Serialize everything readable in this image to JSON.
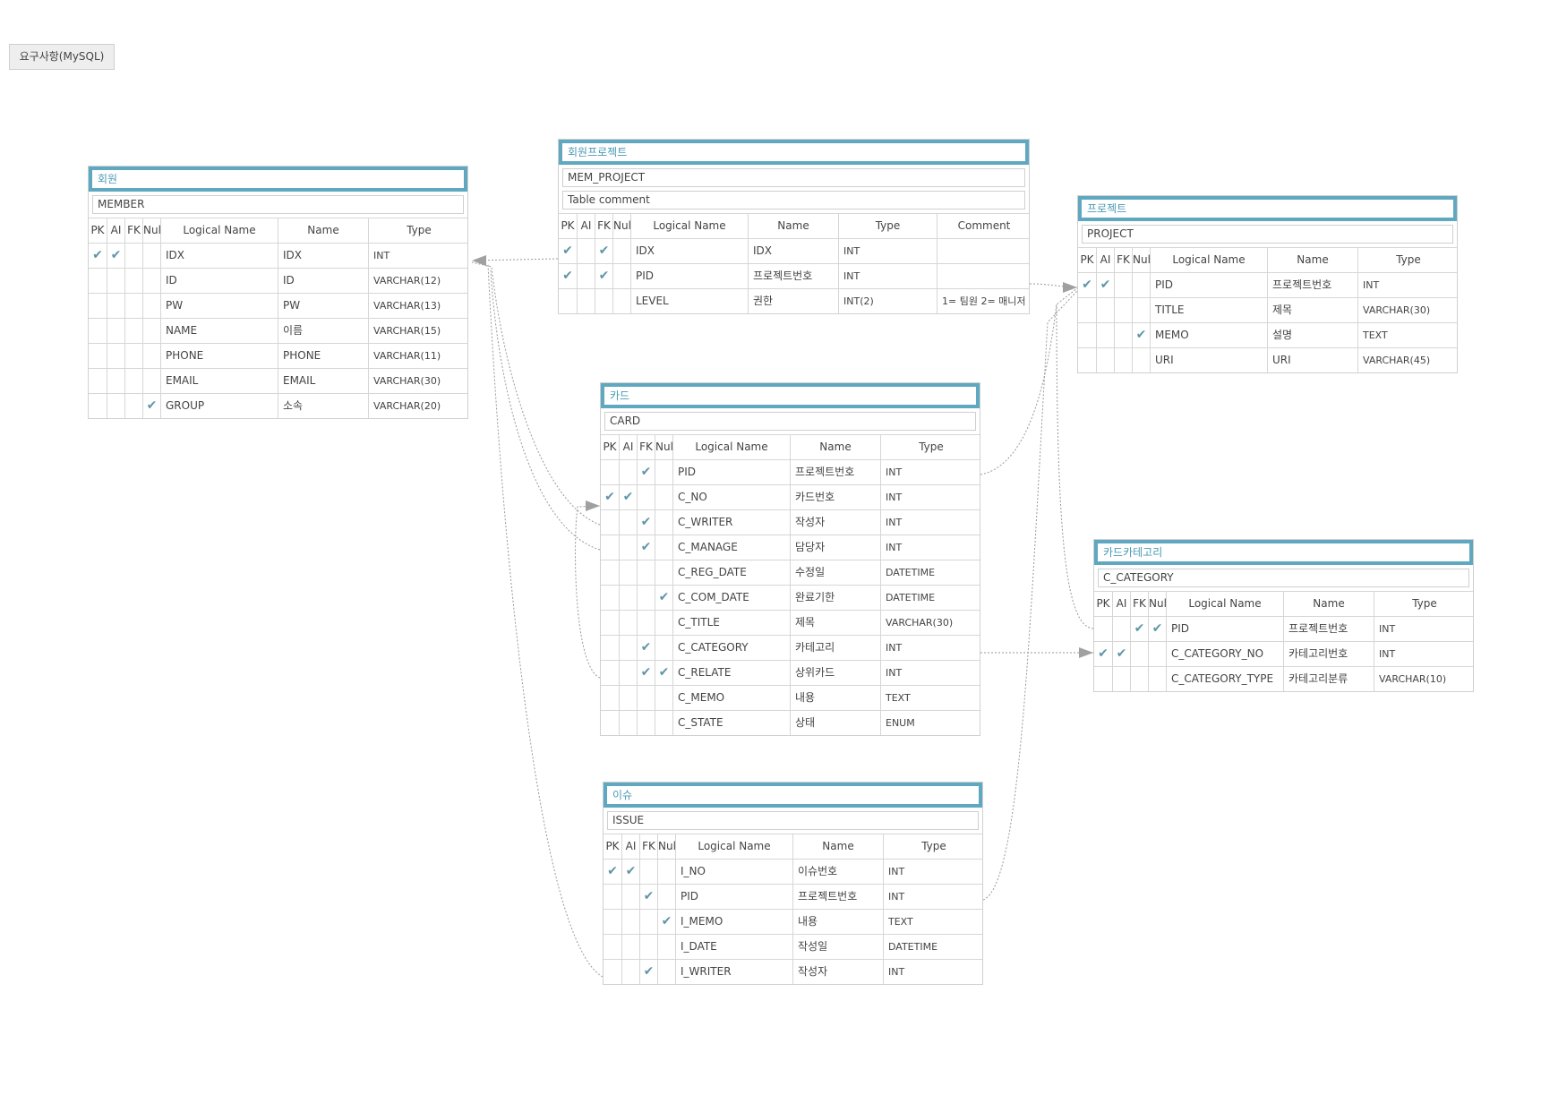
{
  "toolbar": {
    "requirements_label": "요구사항(MySQL)"
  },
  "colors": {
    "accent": "#5fa8c0",
    "check": "#5f96a8",
    "connector": "#999999"
  },
  "icons": {
    "flag": "checkmark-icon"
  },
  "tables": [
    {
      "id": "member",
      "logical": "회원",
      "physical": "MEMBER",
      "has_comment_column": false,
      "columns_header": [
        "PK",
        "AI",
        "FK",
        "Null",
        "Logical Name",
        "Name",
        "Type"
      ],
      "rows": [
        {
          "pk": true,
          "ai": true,
          "fk": false,
          "nul": false,
          "logical": "IDX",
          "name": "IDX",
          "type": "INT"
        },
        {
          "pk": false,
          "ai": false,
          "fk": false,
          "nul": false,
          "logical": "ID",
          "name": "ID",
          "type": "VARCHAR(12)"
        },
        {
          "pk": false,
          "ai": false,
          "fk": false,
          "nul": false,
          "logical": "PW",
          "name": "PW",
          "type": "VARCHAR(13)"
        },
        {
          "pk": false,
          "ai": false,
          "fk": false,
          "nul": false,
          "logical": "NAME",
          "name": "이름",
          "type": "VARCHAR(15)"
        },
        {
          "pk": false,
          "ai": false,
          "fk": false,
          "nul": false,
          "logical": "PHONE",
          "name": "PHONE",
          "type": "VARCHAR(11)"
        },
        {
          "pk": false,
          "ai": false,
          "fk": false,
          "nul": false,
          "logical": "EMAIL",
          "name": "EMAIL",
          "type": "VARCHAR(30)"
        },
        {
          "pk": false,
          "ai": false,
          "fk": false,
          "nul": true,
          "logical": "GROUP",
          "name": "소속",
          "type": "VARCHAR(20)"
        }
      ]
    },
    {
      "id": "mem_project",
      "logical": "회원프로젝트",
      "physical": "MEM_PROJECT",
      "table_comment": "Table comment",
      "has_comment_column": true,
      "columns_header": [
        "PK",
        "AI",
        "FK",
        "Null",
        "Logical Name",
        "Name",
        "Type",
        "Comment"
      ],
      "rows": [
        {
          "pk": true,
          "ai": false,
          "fk": true,
          "nul": false,
          "logical": "IDX",
          "name": "IDX",
          "type": "INT",
          "comment": ""
        },
        {
          "pk": true,
          "ai": false,
          "fk": true,
          "nul": false,
          "logical": "PID",
          "name": "프로젝트번호",
          "type": "INT",
          "comment": ""
        },
        {
          "pk": false,
          "ai": false,
          "fk": false,
          "nul": false,
          "logical": "LEVEL",
          "name": "권한",
          "type": "INT(2)",
          "comment": "1= 팀원 2= 매니저"
        }
      ]
    },
    {
      "id": "project",
      "logical": "프로젝트",
      "physical": "PROJECT",
      "has_comment_column": false,
      "columns_header": [
        "PK",
        "AI",
        "FK",
        "Null",
        "Logical Name",
        "Name",
        "Type"
      ],
      "rows": [
        {
          "pk": true,
          "ai": true,
          "fk": false,
          "nul": false,
          "logical": "PID",
          "name": "프로젝트번호",
          "type": "INT"
        },
        {
          "pk": false,
          "ai": false,
          "fk": false,
          "nul": false,
          "logical": "TITLE",
          "name": "제목",
          "type": "VARCHAR(30)"
        },
        {
          "pk": false,
          "ai": false,
          "fk": false,
          "nul": true,
          "logical": "MEMO",
          "name": "설명",
          "type": "TEXT"
        },
        {
          "pk": false,
          "ai": false,
          "fk": false,
          "nul": false,
          "logical": "URI",
          "name": "URI",
          "type": "VARCHAR(45)"
        }
      ]
    },
    {
      "id": "card",
      "logical": "카드",
      "physical": "CARD",
      "has_comment_column": false,
      "columns_header": [
        "PK",
        "AI",
        "FK",
        "Null",
        "Logical Name",
        "Name",
        "Type"
      ],
      "rows": [
        {
          "pk": false,
          "ai": false,
          "fk": true,
          "nul": false,
          "logical": "PID",
          "name": "프로젝트번호",
          "type": "INT"
        },
        {
          "pk": true,
          "ai": true,
          "fk": false,
          "nul": false,
          "logical": "C_NO",
          "name": "카드번호",
          "type": "INT"
        },
        {
          "pk": false,
          "ai": false,
          "fk": true,
          "nul": false,
          "logical": "C_WRITER",
          "name": "작성자",
          "type": "INT"
        },
        {
          "pk": false,
          "ai": false,
          "fk": true,
          "nul": false,
          "logical": "C_MANAGE",
          "name": "담당자",
          "type": "INT"
        },
        {
          "pk": false,
          "ai": false,
          "fk": false,
          "nul": false,
          "logical": "C_REG_DATE",
          "name": "수정일",
          "type": "DATETIME"
        },
        {
          "pk": false,
          "ai": false,
          "fk": false,
          "nul": true,
          "logical": "C_COM_DATE",
          "name": "완료기한",
          "type": "DATETIME"
        },
        {
          "pk": false,
          "ai": false,
          "fk": false,
          "nul": false,
          "logical": "C_TITLE",
          "name": "제목",
          "type": "VARCHAR(30)"
        },
        {
          "pk": false,
          "ai": false,
          "fk": true,
          "nul": false,
          "logical": "C_CATEGORY",
          "name": "카테고리",
          "type": "INT"
        },
        {
          "pk": false,
          "ai": false,
          "fk": true,
          "nul": true,
          "logical": "C_RELATE",
          "name": "상위카드",
          "type": "INT"
        },
        {
          "pk": false,
          "ai": false,
          "fk": false,
          "nul": false,
          "logical": "C_MEMO",
          "name": "내용",
          "type": "TEXT"
        },
        {
          "pk": false,
          "ai": false,
          "fk": false,
          "nul": false,
          "logical": "C_STATE",
          "name": "상태",
          "type": "ENUM"
        }
      ]
    },
    {
      "id": "c_category",
      "logical": "카드카테고리",
      "physical": "C_CATEGORY",
      "has_comment_column": false,
      "columns_header": [
        "PK",
        "AI",
        "FK",
        "Null",
        "Logical Name",
        "Name",
        "Type"
      ],
      "rows": [
        {
          "pk": false,
          "ai": false,
          "fk": true,
          "nul": true,
          "logical": "PID",
          "name": "프로젝트번호",
          "type": "INT"
        },
        {
          "pk": true,
          "ai": true,
          "fk": false,
          "nul": false,
          "logical": "C_CATEGORY_NO",
          "name": "카테고리번호",
          "type": "INT"
        },
        {
          "pk": false,
          "ai": false,
          "fk": false,
          "nul": false,
          "logical": "C_CATEGORY_TYPE",
          "name": "카테고리분류",
          "type": "VARCHAR(10)"
        }
      ]
    },
    {
      "id": "issue",
      "logical": "이슈",
      "physical": "ISSUE",
      "has_comment_column": false,
      "columns_header": [
        "PK",
        "AI",
        "FK",
        "Null",
        "Logical Name",
        "Name",
        "Type"
      ],
      "rows": [
        {
          "pk": true,
          "ai": true,
          "fk": false,
          "nul": false,
          "logical": "I_NO",
          "name": "이슈번호",
          "type": "INT"
        },
        {
          "pk": false,
          "ai": false,
          "fk": true,
          "nul": false,
          "logical": "PID",
          "name": "프로젝트번호",
          "type": "INT"
        },
        {
          "pk": false,
          "ai": false,
          "fk": false,
          "nul": true,
          "logical": "I_MEMO",
          "name": "내용",
          "type": "TEXT"
        },
        {
          "pk": false,
          "ai": false,
          "fk": false,
          "nul": false,
          "logical": "I_DATE",
          "name": "작성일",
          "type": "DATETIME"
        },
        {
          "pk": false,
          "ai": false,
          "fk": true,
          "nul": false,
          "logical": "I_WRITER",
          "name": "작성자",
          "type": "INT"
        }
      ]
    }
  ]
}
